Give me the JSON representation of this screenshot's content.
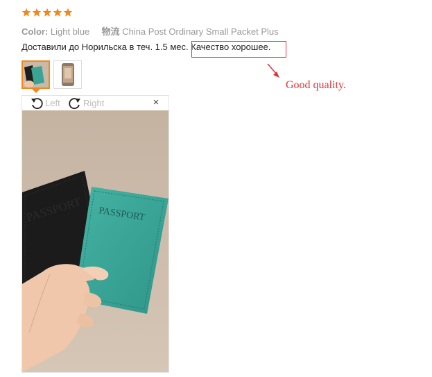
{
  "review": {
    "rating": 5,
    "rating_max": 5,
    "star_color": "#f0891c",
    "color_label": "Color:",
    "color_value": "Light blue",
    "shipping_label": "物流",
    "shipping_value": "China Post Ordinary Small Packet Plus",
    "text_prefix": "Доставили до Норильска в теч. 1.5 мес. ",
    "text_highlight": "Качество хорошее."
  },
  "annotation": {
    "translation": "Good quality.",
    "color": "#e0323a"
  },
  "thumbnails": [
    {
      "name": "passport-covers-photo",
      "active": true
    },
    {
      "name": "phone-photo",
      "active": false
    }
  ],
  "viewer": {
    "rotate_left_label": "Left",
    "rotate_right_label": "Right",
    "close_symbol": "×",
    "rotate_left_icon": "rotate-left-icon",
    "rotate_right_icon": "rotate-right-icon",
    "close_icon": "close-icon",
    "photo_text_black_cover": "PASSPORT",
    "photo_text_teal_cover": "PASSPORT"
  }
}
